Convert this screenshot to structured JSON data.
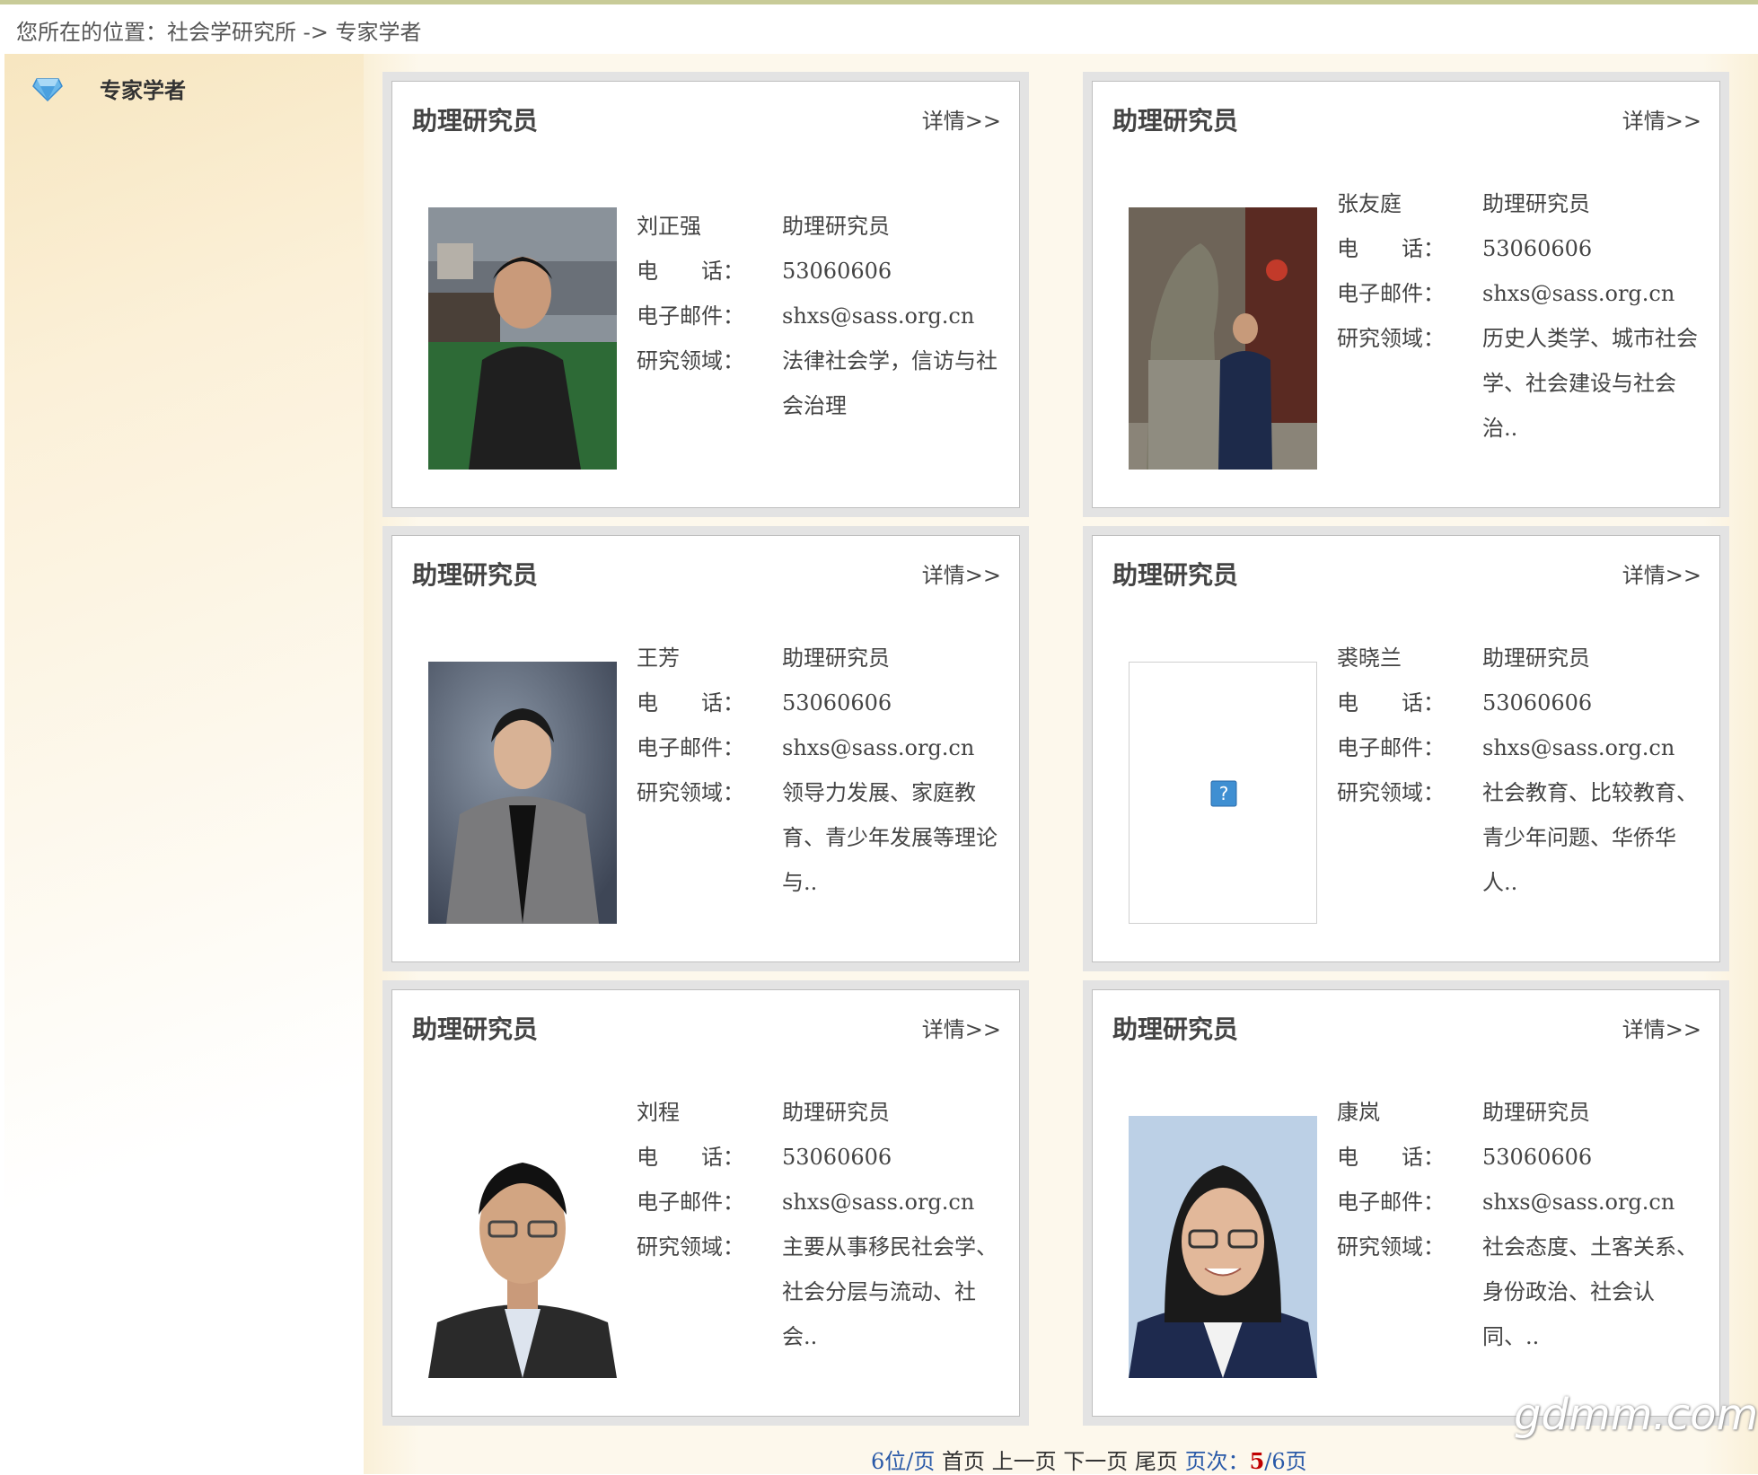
{
  "breadcrumb": {
    "text": "您所在的位置：社会学研究所 -> 专家学者"
  },
  "sidebar": {
    "title": "专家学者",
    "icon": "gem-icon"
  },
  "labels": {
    "phone": "电　　话：",
    "email": "电子邮件：",
    "field": "研究领域："
  },
  "cards": [
    {
      "title": "助理研究员",
      "more": "详情>>",
      "name": "刘正强",
      "position": "助理研究员",
      "phone": "53060606",
      "email": "shxs@sass.org.cn",
      "field": "法律社会学，信访与社会治理",
      "photo": "portrait-photo"
    },
    {
      "title": "助理研究员",
      "more": "详情>>",
      "name": "张友庭",
      "position": "助理研究员",
      "phone": "53060606",
      "email": "shxs@sass.org.cn",
      "field": "历史人类学、城市社会学、社会建设与社会治..",
      "photo": "portrait-photo-statue"
    },
    {
      "title": "助理研究员",
      "more": "详情>>",
      "name": "王芳",
      "position": "助理研究员",
      "phone": "53060606",
      "email": "shxs@sass.org.cn",
      "field": "领导力发展、家庭教育、青少年发展等理论与..",
      "photo": "portrait-photo"
    },
    {
      "title": "助理研究员",
      "more": "详情>>",
      "name": "裘晓兰",
      "position": "助理研究员",
      "phone": "53060606",
      "email": "shxs@sass.org.cn",
      "field": "社会教育、比较教育、青少年问题、华侨华人..",
      "photo": "broken-image-icon"
    },
    {
      "title": "助理研究员",
      "more": "详情>>",
      "name": "刘程",
      "position": "助理研究员",
      "phone": "53060606",
      "email": "shxs@sass.org.cn",
      "field": "主要从事移民社会学、社会分层与流动、社会..",
      "photo": "portrait-photo"
    },
    {
      "title": "助理研究员",
      "more": "详情>>",
      "name": "康岚",
      "position": "助理研究员",
      "phone": "53060606",
      "email": "shxs@sass.org.cn",
      "field": "社会态度、土客关系、身份政治、社会认同、..",
      "photo": "portrait-photo"
    }
  ],
  "pager": {
    "per_page": "6位/页",
    "first": "首页",
    "prev": "上一页",
    "next": "下一页",
    "last": "尾页",
    "page_label": "页次：",
    "current": "5",
    "total": "/6页"
  },
  "watermark": "gdmm.com"
}
